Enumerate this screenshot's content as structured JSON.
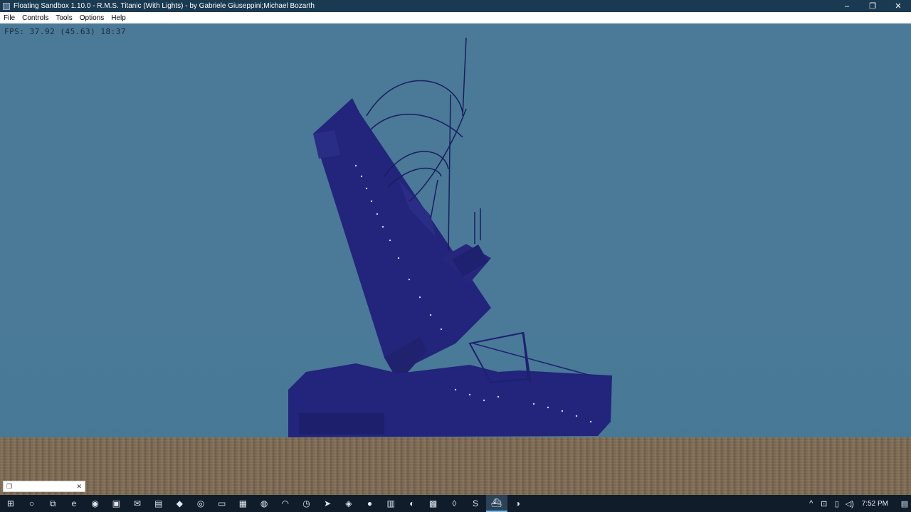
{
  "window": {
    "title": "Floating Sandbox 1.10.0 - R.M.S. Titanic (With Lights) - by Gabriele Giuseppini;Michael Bozarth",
    "minimize_glyph": "–",
    "restore_glyph": "❐",
    "close_glyph": "✕"
  },
  "menu": {
    "items": [
      {
        "label": "File"
      },
      {
        "label": "Controls"
      },
      {
        "label": "Tools"
      },
      {
        "label": "Options"
      },
      {
        "label": "Help"
      }
    ]
  },
  "hud": {
    "fps_text": "FPS: 37.92 (45.63) 18:37"
  },
  "mini_window": {
    "restore_glyph": "❐",
    "close_glyph": "✕"
  },
  "taskbar": {
    "apps": [
      {
        "icon": "windows-start-icon",
        "glyph": "⊞"
      },
      {
        "icon": "cortana-search-icon",
        "glyph": "○"
      },
      {
        "icon": "task-view-icon",
        "glyph": "⧉"
      },
      {
        "icon": "edge-browser-icon",
        "glyph": "e"
      },
      {
        "icon": "opera-icon",
        "glyph": "◉"
      },
      {
        "icon": "store-icon",
        "glyph": "▣"
      },
      {
        "icon": "mail-icon",
        "glyph": "✉"
      },
      {
        "icon": "app-icon",
        "glyph": "▤"
      },
      {
        "icon": "app-icon",
        "glyph": "◆"
      },
      {
        "icon": "chrome-icon",
        "glyph": "◎"
      },
      {
        "icon": "file-explorer-icon",
        "glyph": "▭"
      },
      {
        "icon": "app-icon",
        "glyph": "▦"
      },
      {
        "icon": "chrome-icon",
        "glyph": "◍"
      },
      {
        "icon": "app-icon",
        "glyph": "◠"
      },
      {
        "icon": "app-icon",
        "glyph": "◷"
      },
      {
        "icon": "telegram-icon",
        "glyph": "➤"
      },
      {
        "icon": "minecraft-icon",
        "glyph": "◈"
      },
      {
        "icon": "record-icon",
        "glyph": "●"
      },
      {
        "icon": "app-icon",
        "glyph": "▥"
      },
      {
        "icon": "firefox-icon",
        "glyph": "◐"
      },
      {
        "icon": "app-icon",
        "glyph": "▩"
      },
      {
        "icon": "app-icon",
        "glyph": "◊"
      },
      {
        "icon": "skype-icon",
        "glyph": "S"
      },
      {
        "icon": "floating-sandbox-icon",
        "glyph": "⛴"
      },
      {
        "icon": "app-icon",
        "glyph": "◑"
      }
    ],
    "active_index": 23,
    "tray": {
      "chevron": "^",
      "network": "⊡",
      "usb": "▯",
      "volume": "◁)",
      "time": "7:52 PM",
      "notification": "▤"
    }
  },
  "colors": {
    "water": "#4a7a98",
    "ship": "#22237a",
    "seabed": "#7d6a52",
    "taskbar": "#111c2b"
  }
}
